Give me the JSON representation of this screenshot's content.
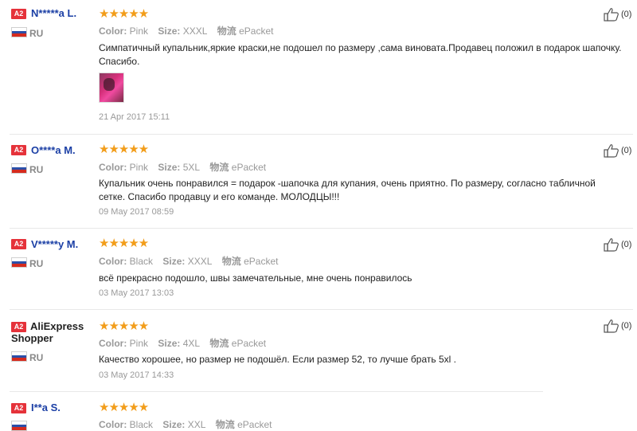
{
  "labels": {
    "color": "Color:",
    "size": "Size:",
    "shipping": "物流"
  },
  "colors": {
    "badge": "#e5323a",
    "name": "#1b3fa5",
    "star": "#f29d1a",
    "muted": "#999999"
  },
  "reviews": [
    {
      "badge": "A2",
      "name": "N*****a L.",
      "country": "RU",
      "stars": "★★★★★",
      "color": "Pink",
      "size": "XXXL",
      "shipping": "ePacket",
      "text": "Симпатичный купальник,яркие краски,не подошел по размеру ,сама виновата.Продавец положил в подарок шапочку. Спасибо.",
      "date": "21 Apr 2017 15:11",
      "likes": "(0)",
      "has_photo": true
    },
    {
      "badge": "A2",
      "name": "O****a M.",
      "country": "RU",
      "stars": "★★★★★",
      "color": "Pink",
      "size": "5XL",
      "shipping": "ePacket",
      "text": "Купальник очень понравился = подарок -шапочка для купания, очень приятно. По размеру, согласно табличной сетке. Спасибо продавцу и его команде. МОЛОДЦЫ!!!",
      "date": "09 May 2017 08:59",
      "likes": "(0)"
    },
    {
      "badge": "A2",
      "name": "V*****y M.",
      "country": "RU",
      "stars": "★★★★★",
      "color": "Black",
      "size": "XXXL",
      "shipping": "ePacket",
      "text": "всё прекрасно подошло, швы замечательные, мне очень понравилось",
      "date": "03 May 2017 13:03",
      "likes": "(0)"
    },
    {
      "badge": "A2",
      "name": "AliExpress Shopper",
      "country": "RU",
      "stars": "★★★★★",
      "color": "Pink",
      "size": "4XL",
      "shipping": "ePacket",
      "text": "Качество хорошее, но размер не подошёл. Если размер 52, то лучше брать 5xl .",
      "date": "03 May 2017 14:33",
      "likes": "(0)"
    },
    {
      "badge": "A2",
      "name": "I**a S.",
      "country": "",
      "stars": "★★★★★",
      "color": "Black",
      "size": "XXL",
      "shipping": "ePacket",
      "text": "",
      "date": "",
      "likes": ""
    }
  ]
}
